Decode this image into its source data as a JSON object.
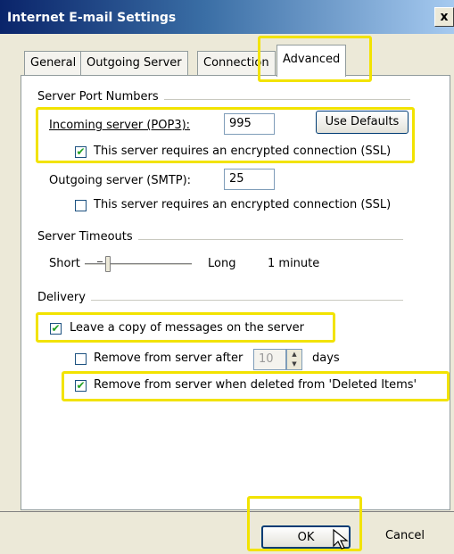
{
  "window": {
    "title": "Internet E-mail Settings",
    "close_glyph": "x"
  },
  "tabs": [
    {
      "label": "General"
    },
    {
      "label": "Outgoing Server"
    },
    {
      "label": "Connection"
    },
    {
      "label": "Advanced",
      "active": true
    }
  ],
  "server_ports": {
    "group_label": "Server Port Numbers",
    "incoming_label": "Incoming server (POP3):",
    "incoming_value": "995",
    "use_defaults_label": "Use Defaults",
    "incoming_ssl_label": "This server requires an encrypted connection (SSL)",
    "incoming_ssl_checked": true,
    "outgoing_label": "Outgoing server (SMTP):",
    "outgoing_value": "25",
    "outgoing_ssl_label": "This server requires an encrypted connection (SSL)",
    "outgoing_ssl_checked": false
  },
  "timeouts": {
    "group_label": "Server Timeouts",
    "short_label": "Short",
    "long_label": "Long",
    "value_label": "1 minute"
  },
  "delivery": {
    "group_label": "Delivery",
    "leave_copy_label": "Leave a copy of messages on the server",
    "leave_copy_checked": true,
    "remove_after_label": "Remove from server after",
    "remove_after_checked": false,
    "remove_after_days": "10",
    "days_label": "days",
    "remove_deleted_label": "Remove from server when deleted from 'Deleted Items'",
    "remove_deleted_checked": true
  },
  "footer": {
    "ok_label": "OK",
    "cancel_label": "Cancel"
  },
  "colors": {
    "highlight": "#f2e300",
    "title_bar_start": "#0a246a"
  }
}
